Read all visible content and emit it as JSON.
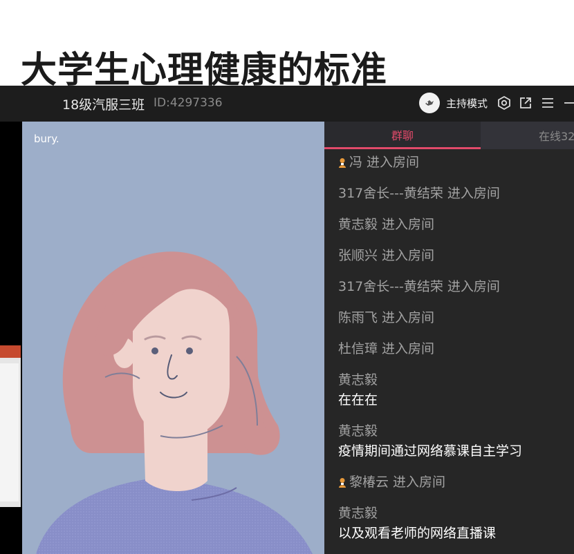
{
  "slide": {
    "title": "大学生心理健康的标准"
  },
  "window": {
    "room_name": "18级汽服三班",
    "room_id": "ID:4297336",
    "host_mode": "主持模式"
  },
  "video": {
    "participant_name": "bury."
  },
  "chat": {
    "tabs": {
      "group_chat": "群聊",
      "online": "在线32"
    },
    "system_messages": [
      "冯 进入房间",
      "317舍长---黄结荣 进入房间",
      "黄志毅 进入房间",
      "张顺兴 进入房间",
      "317舍长---黄结荣 进入房间",
      "陈雨飞 进入房间",
      "杜信璋 进入房间",
      "黎椿云 进入房间"
    ],
    "messages": [
      {
        "sender": "黄志毅",
        "text": "在在在"
      },
      {
        "sender": "黄志毅",
        "text": "疫情期间通过网络慕课自主学习"
      },
      {
        "sender": "黄志毅",
        "text": "以及观看老师的网络直播课"
      }
    ]
  },
  "colors": {
    "accent": "#e24a6a",
    "video_bg": "#9daec9",
    "hair": "#cd9192",
    "skin": "#f0d3cd",
    "shirt": "#8a8fc9"
  },
  "icons": [
    "settings-icon",
    "popout-icon",
    "menu-icon",
    "minimize-icon",
    "user-badge-icon"
  ]
}
